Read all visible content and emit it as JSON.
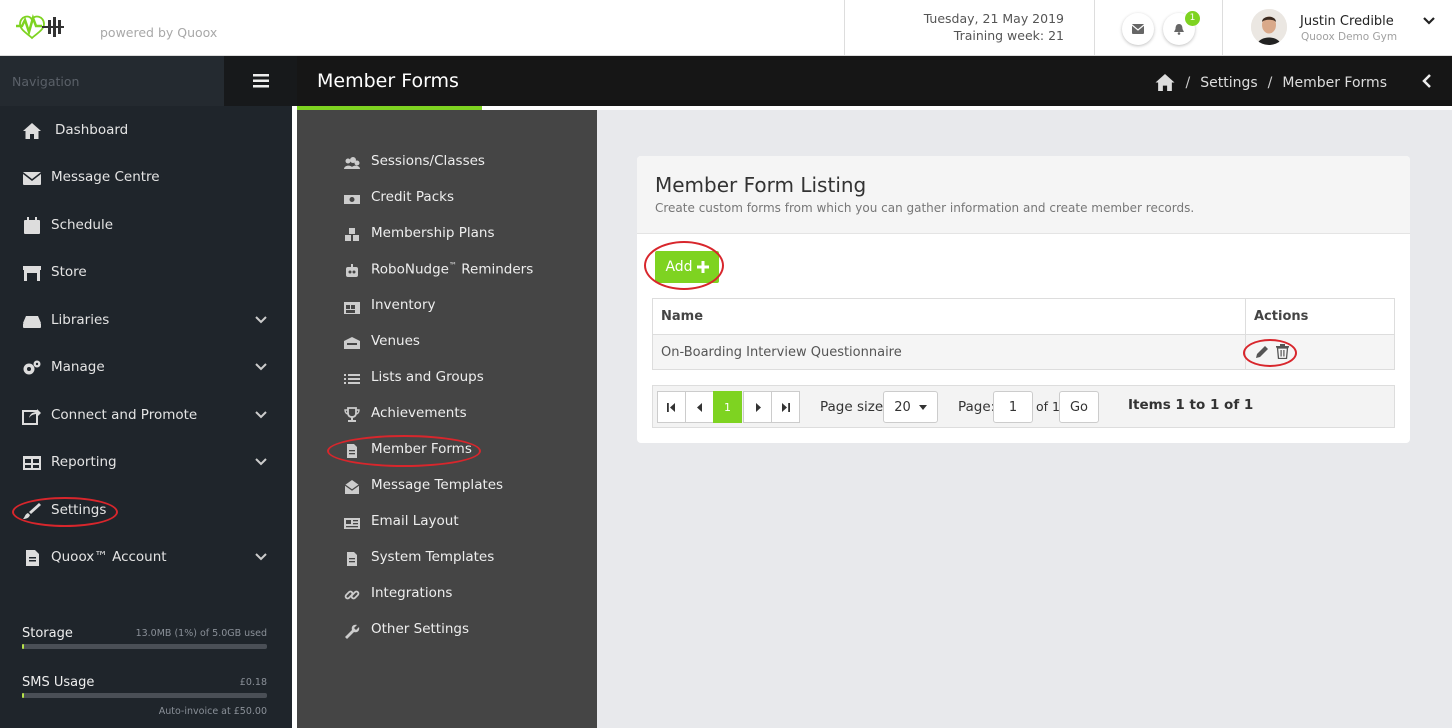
{
  "brand": {
    "powered_by": "powered by Quoox"
  },
  "header": {
    "date": "Tuesday, 21 May 2019",
    "training_week": "Training week: 21",
    "notification_count": "1"
  },
  "user": {
    "name": "Justin Credible",
    "gym": "Quoox Demo Gym"
  },
  "nav": {
    "heading": "Navigation",
    "items": [
      {
        "label": "Dashboard",
        "icon": "home-icon",
        "expandable": false
      },
      {
        "label": "Message Centre",
        "icon": "envelope-icon",
        "expandable": false
      },
      {
        "label": "Schedule",
        "icon": "calendar-icon",
        "expandable": false
      },
      {
        "label": "Store",
        "icon": "store-icon",
        "expandable": false
      },
      {
        "label": "Libraries",
        "icon": "drive-icon",
        "expandable": true
      },
      {
        "label": "Manage",
        "icon": "cogs-icon",
        "expandable": true
      },
      {
        "label": "Connect and Promote",
        "icon": "share-icon",
        "expandable": true
      },
      {
        "label": "Reporting",
        "icon": "table-icon",
        "expandable": true
      },
      {
        "label": "Settings",
        "icon": "brush-icon",
        "expandable": false,
        "highlighted": true
      },
      {
        "label": "Quoox™ Account",
        "icon": "document-icon",
        "expandable": true
      }
    ],
    "storage": {
      "label": "Storage",
      "value": "13.0MB (1%) of 5.0GB used",
      "percent": 1
    },
    "sms": {
      "label": "SMS Usage",
      "value": "£0.18",
      "percent": 1
    },
    "auto_invoice": "Auto-invoice at £50.00"
  },
  "page": {
    "title": "Member Forms",
    "breadcrumb": [
      "Settings",
      "Member Forms"
    ],
    "separator": "/"
  },
  "submenu": {
    "items": [
      {
        "label": "Sessions/Classes",
        "icon": "users-icon"
      },
      {
        "label": "Credit Packs",
        "icon": "money-icon"
      },
      {
        "label": "Membership Plans",
        "icon": "cubes-icon"
      },
      {
        "label": "RoboNudge",
        "sup": "™",
        "label_suffix": " Reminders",
        "icon": "robot-icon"
      },
      {
        "label": "Inventory",
        "icon": "warehouse-icon"
      },
      {
        "label": "Venues",
        "icon": "building-icon"
      },
      {
        "label": "Lists and Groups",
        "icon": "list-icon"
      },
      {
        "label": "Achievements",
        "icon": "trophy-icon"
      },
      {
        "label": "Member Forms",
        "icon": "form-icon",
        "active": true
      },
      {
        "label": "Message Templates",
        "icon": "envelope-open-icon"
      },
      {
        "label": "Email Layout",
        "icon": "newspaper-icon"
      },
      {
        "label": "System Templates",
        "icon": "file-icon"
      },
      {
        "label": "Integrations",
        "icon": "link-icon"
      },
      {
        "label": "Other Settings",
        "icon": "wrench-icon"
      }
    ]
  },
  "card": {
    "title": "Member Form Listing",
    "subtitle": "Create custom forms from which you can gather information and create member records.",
    "add_label": "Add"
  },
  "table": {
    "columns": [
      "Name",
      "Actions"
    ],
    "rows": [
      {
        "name": "On-Boarding Interview Questionnaire"
      }
    ]
  },
  "pager": {
    "current_page": "1",
    "page_size_label": "Page size:",
    "page_size": "20",
    "page_label": "Page:",
    "page_value": "1",
    "of_label": "of 1",
    "go_label": "Go",
    "items_label": "Items 1 to 1 of 1"
  },
  "colors": {
    "accent": "#7ed321",
    "highlight": "#d8262c",
    "nav_bg": "#1f252b",
    "submenu_bg": "#454545"
  }
}
